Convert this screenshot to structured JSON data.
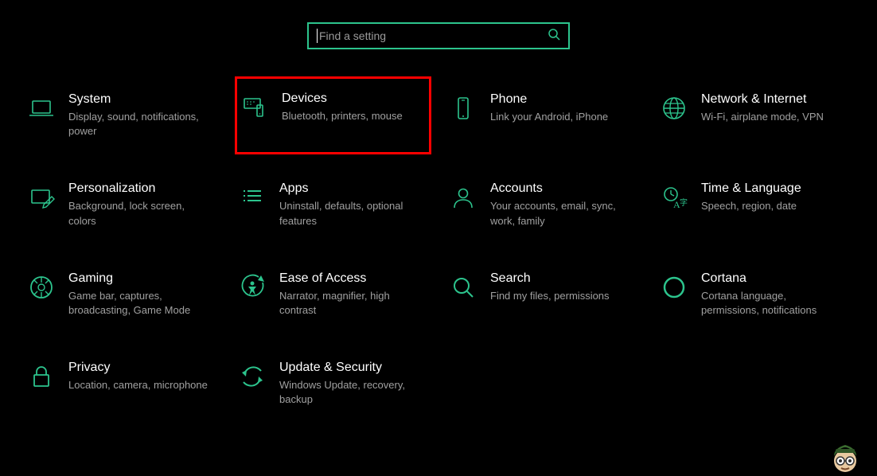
{
  "search": {
    "placeholder": "Find a setting"
  },
  "categories": [
    {
      "title": "System",
      "desc": "Display, sound, notifications, power",
      "icon": "laptop",
      "highlighted": false
    },
    {
      "title": "Devices",
      "desc": "Bluetooth, printers, mouse",
      "icon": "devices",
      "highlighted": true
    },
    {
      "title": "Phone",
      "desc": "Link your Android, iPhone",
      "icon": "phone",
      "highlighted": false
    },
    {
      "title": "Network & Internet",
      "desc": "Wi-Fi, airplane mode, VPN",
      "icon": "globe",
      "highlighted": false
    },
    {
      "title": "Personalization",
      "desc": "Background, lock screen, colors",
      "icon": "personalization",
      "highlighted": false
    },
    {
      "title": "Apps",
      "desc": "Uninstall, defaults, optional features",
      "icon": "apps",
      "highlighted": false
    },
    {
      "title": "Accounts",
      "desc": "Your accounts, email, sync, work, family",
      "icon": "account",
      "highlighted": false
    },
    {
      "title": "Time & Language",
      "desc": "Speech, region, date",
      "icon": "time-lang",
      "highlighted": false
    },
    {
      "title": "Gaming",
      "desc": "Game bar, captures, broadcasting, Game Mode",
      "icon": "gaming",
      "highlighted": false
    },
    {
      "title": "Ease of Access",
      "desc": "Narrator, magnifier, high contrast",
      "icon": "ease",
      "highlighted": false
    },
    {
      "title": "Search",
      "desc": "Find my files, permissions",
      "icon": "search",
      "highlighted": false
    },
    {
      "title": "Cortana",
      "desc": "Cortana language, permissions, notifications",
      "icon": "cortana",
      "highlighted": false
    },
    {
      "title": "Privacy",
      "desc": "Location, camera, microphone",
      "icon": "privacy",
      "highlighted": false
    },
    {
      "title": "Update & Security",
      "desc": "Windows Update, recovery, backup",
      "icon": "update",
      "highlighted": false
    }
  ],
  "accent": "#2cc48d",
  "highlight": "#ff0000"
}
